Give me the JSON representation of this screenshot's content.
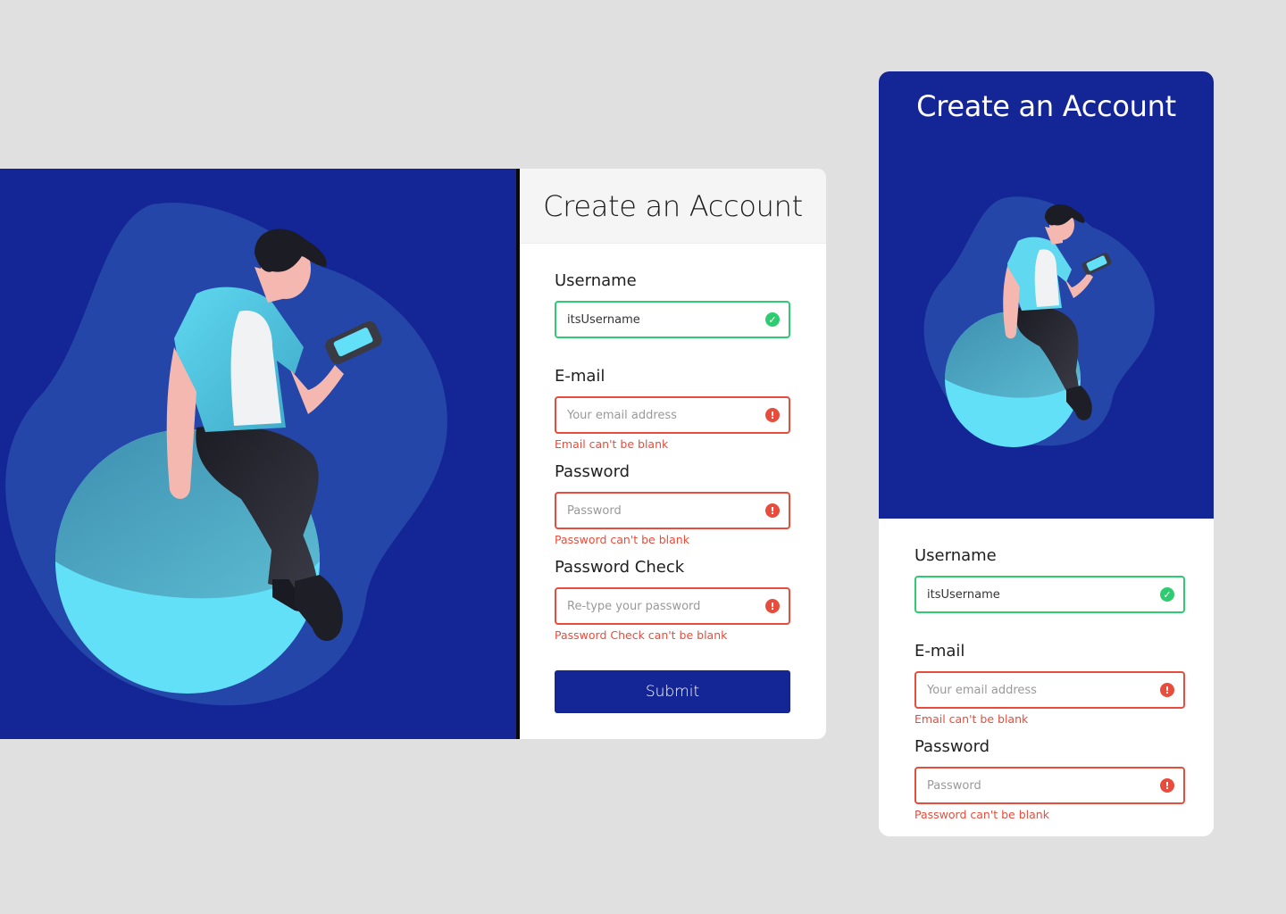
{
  "desktop": {
    "title": "Create an Account",
    "fields": [
      {
        "label": "Username",
        "value": "itsUsername",
        "placeholder": "",
        "status": "valid",
        "error": ""
      },
      {
        "label": "E-mail",
        "value": "",
        "placeholder": "Your email address",
        "status": "error",
        "error": "Email can't be blank"
      },
      {
        "label": "Password",
        "value": "",
        "placeholder": "Password",
        "status": "error",
        "error": "Password can't be blank"
      },
      {
        "label": "Password Check",
        "value": "",
        "placeholder": "Re-type your password",
        "status": "error",
        "error": "Password Check can't be blank"
      }
    ],
    "submit_label": "Submit"
  },
  "mobile": {
    "title": "Create an Account",
    "fields": [
      {
        "label": "Username",
        "value": "itsUsername",
        "placeholder": "",
        "status": "valid",
        "error": ""
      },
      {
        "label": "E-mail",
        "value": "",
        "placeholder": "Your email address",
        "status": "error",
        "error": "Email can't be blank"
      },
      {
        "label": "Password",
        "value": "",
        "placeholder": "Password",
        "status": "error",
        "error": "Password can't be blank"
      }
    ]
  },
  "icons": {
    "valid": "check-circle-icon",
    "error": "exclamation-circle-icon"
  },
  "colors": {
    "brand": "#142596",
    "valid": "#2ecc71",
    "error": "#e74c3c",
    "background": "#e0e0e0"
  }
}
